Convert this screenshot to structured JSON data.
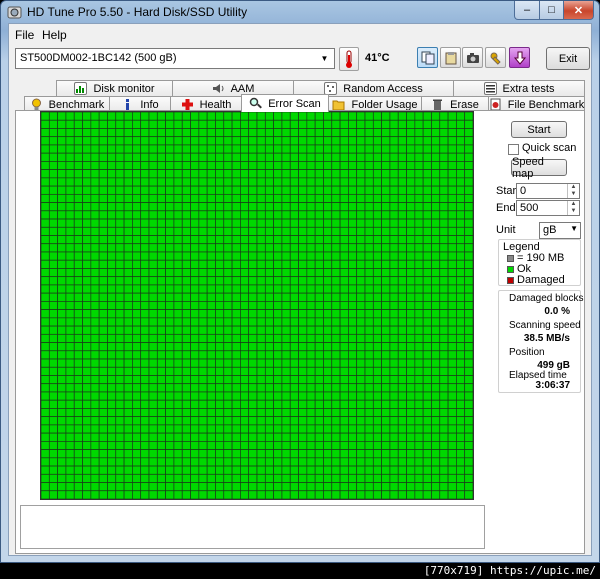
{
  "window": {
    "title": "HD Tune Pro 5.50 - Hard Disk/SSD Utility",
    "minimize": "–",
    "maximize": "□",
    "close": "✕"
  },
  "menu": {
    "file": "File",
    "help": "Help"
  },
  "toolbar": {
    "drive": "ST500DM002-1BC142 (500 gB)",
    "temperature": "41",
    "temperature_unit": "°C",
    "exit": "Exit"
  },
  "tabs_top": [
    "Disk monitor",
    "AAM",
    "Random Access",
    "Extra tests"
  ],
  "tabs_bottom": [
    "Benchmark",
    "Info",
    "Health",
    "Error Scan",
    "Folder Usage",
    "Erase",
    "File Benchmark"
  ],
  "active_tab": "Error Scan",
  "controls": {
    "start_button": "Start",
    "quick_scan_label": "Quick scan",
    "speed_map_button": "Speed map",
    "start_label": "Start",
    "start_value": "0",
    "end_label": "End",
    "end_value": "500",
    "unit_label": "Unit",
    "unit_value": "gB"
  },
  "legend": {
    "title": "Legend",
    "block_size": "= 190 MB",
    "ok": "Ok",
    "damaged": "Damaged",
    "colors": {
      "ok": "#00d800",
      "damaged": "#c00000",
      "block": "#888888"
    }
  },
  "stats": {
    "damaged_blocks_label": "Damaged blocks",
    "damaged_blocks_value": "0.0 %",
    "scanning_speed_label": "Scanning speed",
    "scanning_speed_value": "38.5 MB/s",
    "position_label": "Position",
    "position_value": "499 gB",
    "elapsed_label": "Elapsed time",
    "elapsed_value": "3:06:37"
  },
  "scan": {
    "columns": 52,
    "rows": 47,
    "ok_fraction": 1.0,
    "cell_color": "#00d800",
    "line_color": "#1a3a1a"
  },
  "watermark": "[770x719] https://upic.me/"
}
